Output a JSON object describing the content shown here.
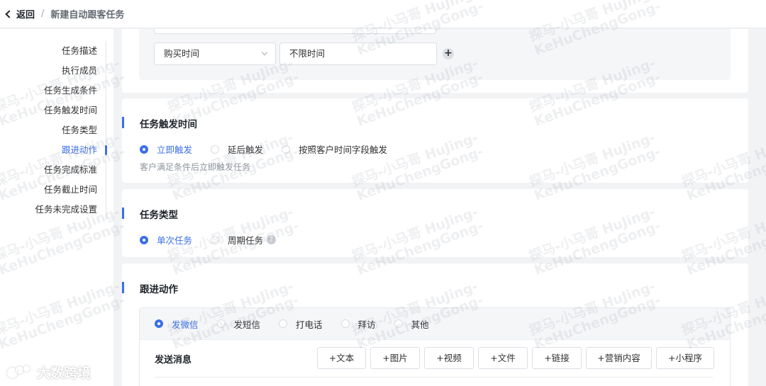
{
  "header": {
    "back_label": "返回",
    "separator": "/",
    "page_title": "新建自动跟客任务"
  },
  "sidebar": {
    "items": [
      {
        "label": "任务描述"
      },
      {
        "label": "执行成员"
      },
      {
        "label": "任务生成条件"
      },
      {
        "label": "任务触发时间"
      },
      {
        "label": "任务类型"
      },
      {
        "label": "跟进动作",
        "active": true
      },
      {
        "label": "任务完成标准"
      },
      {
        "label": "任务截止时间"
      },
      {
        "label": "任务未完成设置"
      }
    ]
  },
  "conditions": {
    "field_select": "购买时间",
    "field_value": "不限时间",
    "add_label": "+"
  },
  "trigger": {
    "title": "任务触发时间",
    "options": [
      "立即触发",
      "延后触发",
      "按照客户时间字段触发"
    ],
    "selected": "立即触发",
    "hint": "客户满足条件后立即触发任务"
  },
  "task_type": {
    "title": "任务类型",
    "options": [
      "单次任务",
      "周期任务"
    ],
    "selected": "单次任务",
    "help_icon": "?"
  },
  "follow_action": {
    "title": "跟进动作",
    "options": [
      "发微信",
      "发短信",
      "打电话",
      "拜访",
      "其他"
    ],
    "selected": "发微信",
    "send_label": "发送消息",
    "buttons": [
      "+文本",
      "+图片",
      "+视频",
      "+文件",
      "+链接",
      "+营销内容",
      "+小程序"
    ]
  },
  "watermark": {
    "line1": "探马-小马哥 HuJing-",
    "line2": "KeHuChengGong-"
  },
  "brand": {
    "label": "大数跨境"
  },
  "colors": {
    "accent": "#3b6fe8",
    "background": "#f2f3f5"
  }
}
